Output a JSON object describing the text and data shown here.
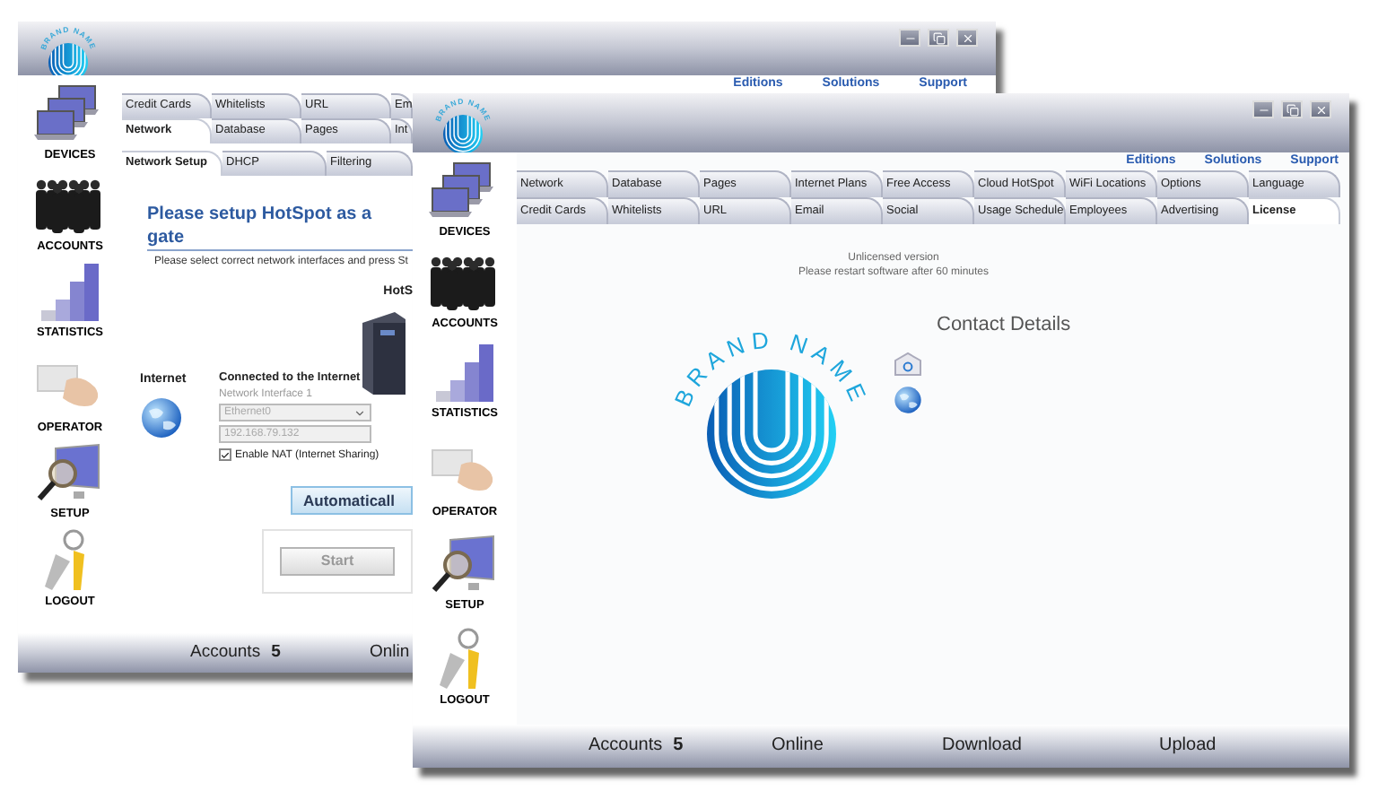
{
  "back_window": {
    "logo_text": "BRAND NAME",
    "header_links": [
      "Editions",
      "Solutions",
      "Support"
    ],
    "sidebar": [
      {
        "label": "DEVICES",
        "kind": "devices"
      },
      {
        "label": "ACCOUNTS",
        "kind": "accounts"
      },
      {
        "label": "STATISTICS",
        "kind": "statistics"
      },
      {
        "label": "OPERATOR",
        "kind": "operator"
      },
      {
        "label": "SETUP",
        "kind": "setup"
      },
      {
        "label": "LOGOUT",
        "kind": "logout"
      }
    ],
    "tab_rows": [
      [
        {
          "label": "Credit Cards",
          "selected": false
        },
        {
          "label": "Whitelists",
          "selected": false
        },
        {
          "label": "URL",
          "selected": false
        },
        {
          "label": "Em",
          "selected": false
        }
      ],
      [
        {
          "label": "Network",
          "selected": true
        },
        {
          "label": "Database",
          "selected": false
        },
        {
          "label": "Pages",
          "selected": false
        },
        {
          "label": "Int",
          "selected": false
        }
      ]
    ],
    "subtabs": [
      {
        "label": "Network Setup",
        "selected": true
      },
      {
        "label": "DHCP",
        "selected": false
      },
      {
        "label": "Filtering",
        "selected": false
      }
    ],
    "heading": "Please setup HotSpot as a gate",
    "instructions": "Please select correct network interfaces and press St",
    "hotspot_label": "HotS",
    "internet_label": "Internet",
    "connection": {
      "title": "Connected to the Internet",
      "interface_label": "Network Interface 1",
      "interface": "Ethernet0",
      "ip": "192.168.79.132",
      "nat": {
        "label": "Enable NAT (Internet Sharing)",
        "checked": true
      }
    },
    "auto_button": "Automaticall",
    "start_button": {
      "label": "Start",
      "disabled": true
    },
    "status_bar": [
      {
        "label": "Accounts",
        "value": "5"
      },
      {
        "label": "Onlin"
      }
    ]
  },
  "front_window": {
    "logo_text": "BRAND NAME",
    "header_links": [
      "Editions",
      "Solutions",
      "Support"
    ],
    "sidebar": [
      {
        "label": "DEVICES",
        "kind": "devices"
      },
      {
        "label": "ACCOUNTS",
        "kind": "accounts"
      },
      {
        "label": "STATISTICS",
        "kind": "statistics"
      },
      {
        "label": "OPERATOR",
        "kind": "operator"
      },
      {
        "label": "SETUP",
        "kind": "setup"
      },
      {
        "label": "LOGOUT",
        "kind": "logout"
      }
    ],
    "tab_rows": [
      [
        {
          "label": "Network",
          "selected": false
        },
        {
          "label": "Database",
          "selected": false
        },
        {
          "label": "Pages",
          "selected": false
        },
        {
          "label": "Internet Plans",
          "selected": false
        },
        {
          "label": "Free Access",
          "selected": false
        },
        {
          "label": "Cloud HotSpot",
          "selected": false
        },
        {
          "label": "WiFi Locations",
          "selected": false
        },
        {
          "label": "Options",
          "selected": false
        },
        {
          "label": "Language",
          "selected": false
        }
      ],
      [
        {
          "label": "Credit Cards",
          "selected": false
        },
        {
          "label": "Whitelists",
          "selected": false
        },
        {
          "label": "URL",
          "selected": false
        },
        {
          "label": "Email",
          "selected": false
        },
        {
          "label": "Social",
          "selected": false
        },
        {
          "label": "Usage Schedule",
          "selected": false
        },
        {
          "label": "Employees",
          "selected": false
        },
        {
          "label": "Advertising",
          "selected": false
        },
        {
          "label": "License",
          "selected": true
        }
      ]
    ],
    "license_notice": [
      "Unlicensed version",
      "Please restart software after 60 minutes"
    ],
    "brand_logo_text": "BRAND NAME",
    "contact_title": "Contact Details",
    "status_bar": [
      {
        "label": "Accounts",
        "value": "5"
      },
      {
        "label": "Online"
      },
      {
        "label": "Download"
      },
      {
        "label": "Upload"
      }
    ]
  }
}
